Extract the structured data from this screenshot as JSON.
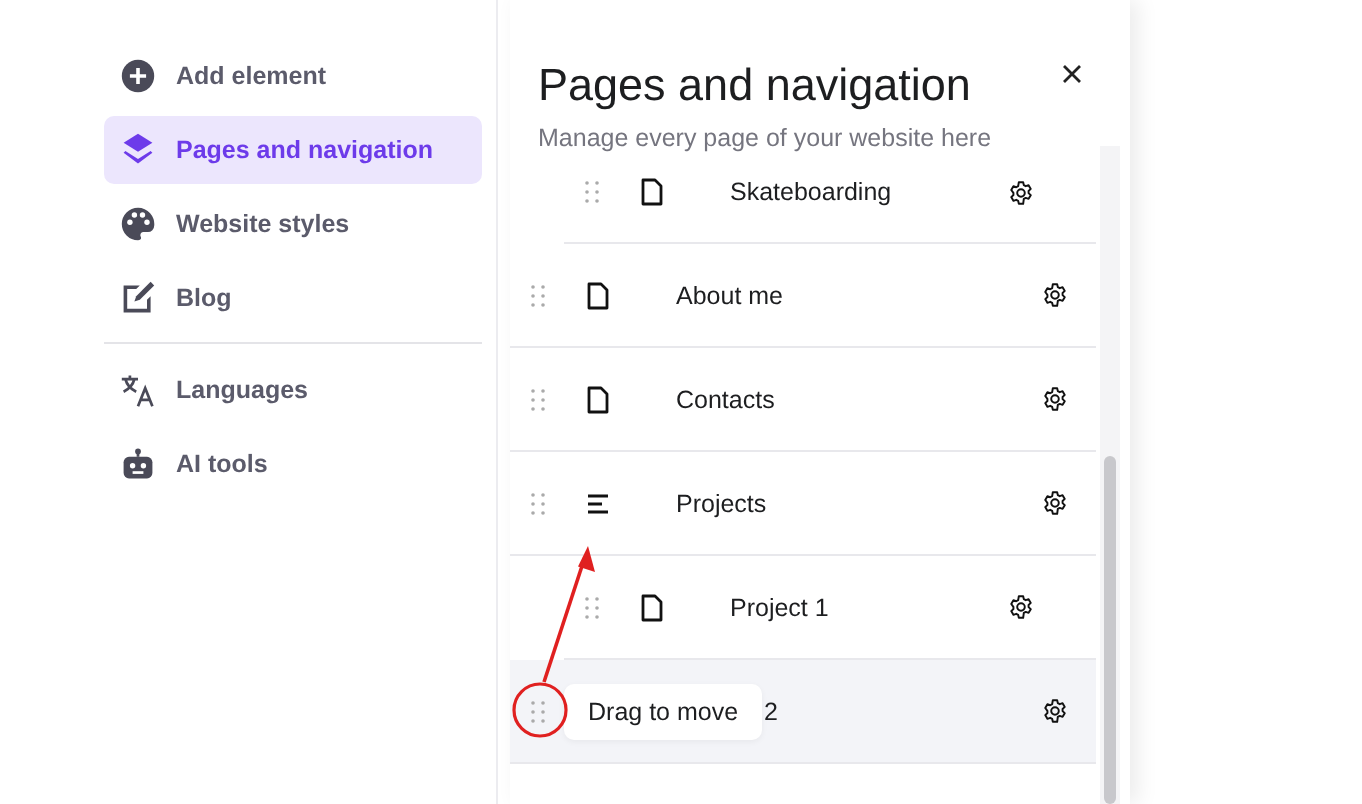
{
  "sidebar": {
    "items": [
      {
        "label": "Add element",
        "selected": false
      },
      {
        "label": "Pages and navigation",
        "selected": true
      },
      {
        "label": "Website styles",
        "selected": false
      },
      {
        "label": "Blog",
        "selected": false
      },
      {
        "label": "Languages",
        "selected": false
      },
      {
        "label": "AI tools",
        "selected": false
      }
    ]
  },
  "panel": {
    "title": "Pages and navigation",
    "subtitle": "Manage every page of your website here",
    "pages": [
      {
        "children": [
          {
            "label": "Skateboarding",
            "kind": "page",
            "highlighted": false
          }
        ]
      },
      {
        "label": "About me",
        "kind": "page",
        "highlighted": false
      },
      {
        "label": "Contacts",
        "kind": "page",
        "highlighted": false
      },
      {
        "label": "Projects",
        "kind": "group",
        "highlighted": false,
        "children": [
          {
            "label": "Project 1",
            "kind": "page",
            "highlighted": false
          }
        ]
      },
      {
        "label": "2",
        "highlighted": true,
        "tooltip": "Drag to move"
      }
    ]
  }
}
